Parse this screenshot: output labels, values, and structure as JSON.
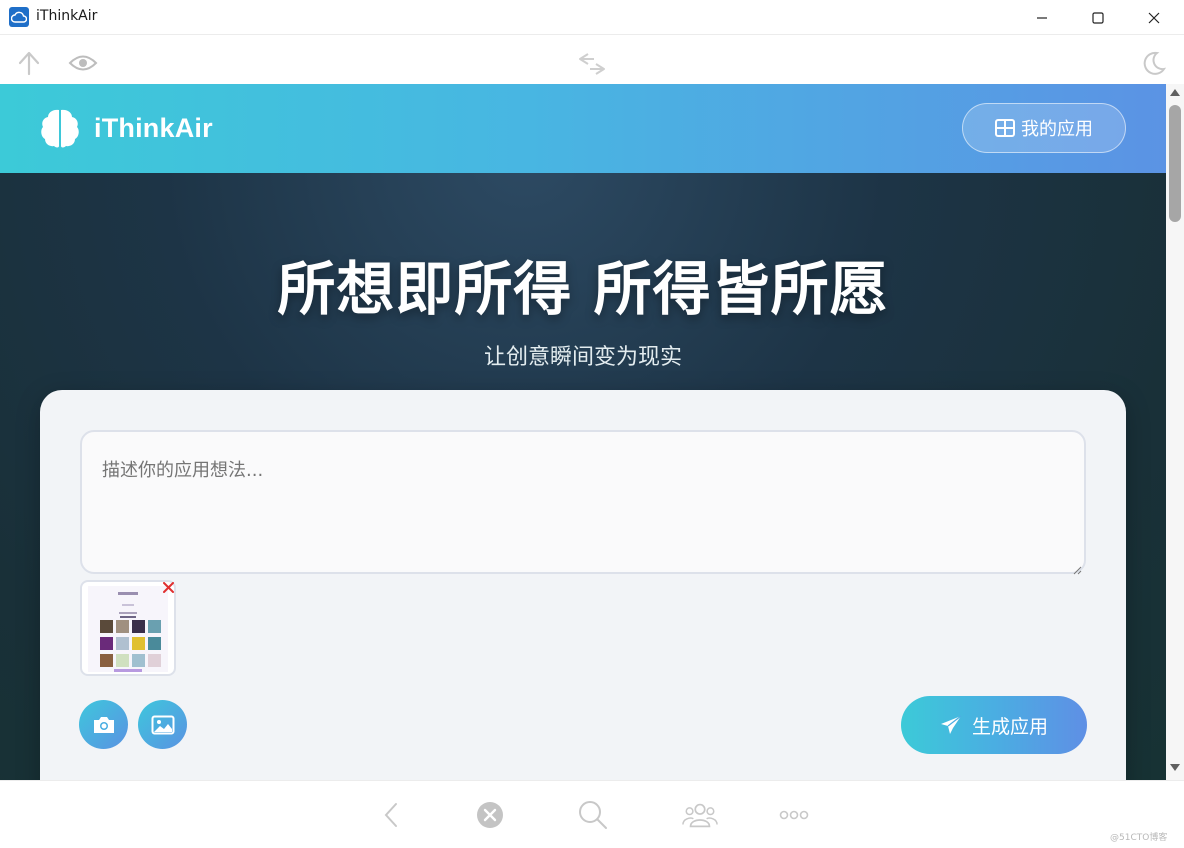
{
  "window": {
    "title": "iThinkAir"
  },
  "header": {
    "logo_text": "iThinkAir",
    "my_apps_label": "我的应用"
  },
  "hero": {
    "title": "所想即所得 所得皆所愿",
    "subtitle": "让创意瞬间变为现实"
  },
  "composer": {
    "prompt_placeholder": "描述你的应用想法...",
    "prompt_value": "",
    "generate_label": "生成应用",
    "attachment": {
      "kind": "image-thumbnail"
    }
  },
  "icons": {
    "titlebar": [
      "app-icon",
      "minimize-icon",
      "maximize-icon",
      "close-icon"
    ],
    "toolbar": [
      "upload-arrow-icon",
      "eye-icon",
      "swap-arrows-icon",
      "moon-icon"
    ],
    "composer": [
      "camera-icon",
      "image-icon",
      "send-icon",
      "remove-attachment-icon"
    ],
    "bottom_nav": [
      "back-icon",
      "stop-icon",
      "search-icon",
      "people-icon",
      "more-icon"
    ]
  },
  "colors": {
    "accent_start": "#3ccad8",
    "accent_end": "#5f8fe5",
    "hero_bg": "#1d3446",
    "card_bg": "#f2f4f7",
    "remove_red": "#e03030"
  },
  "watermark": "@51CTO博客"
}
